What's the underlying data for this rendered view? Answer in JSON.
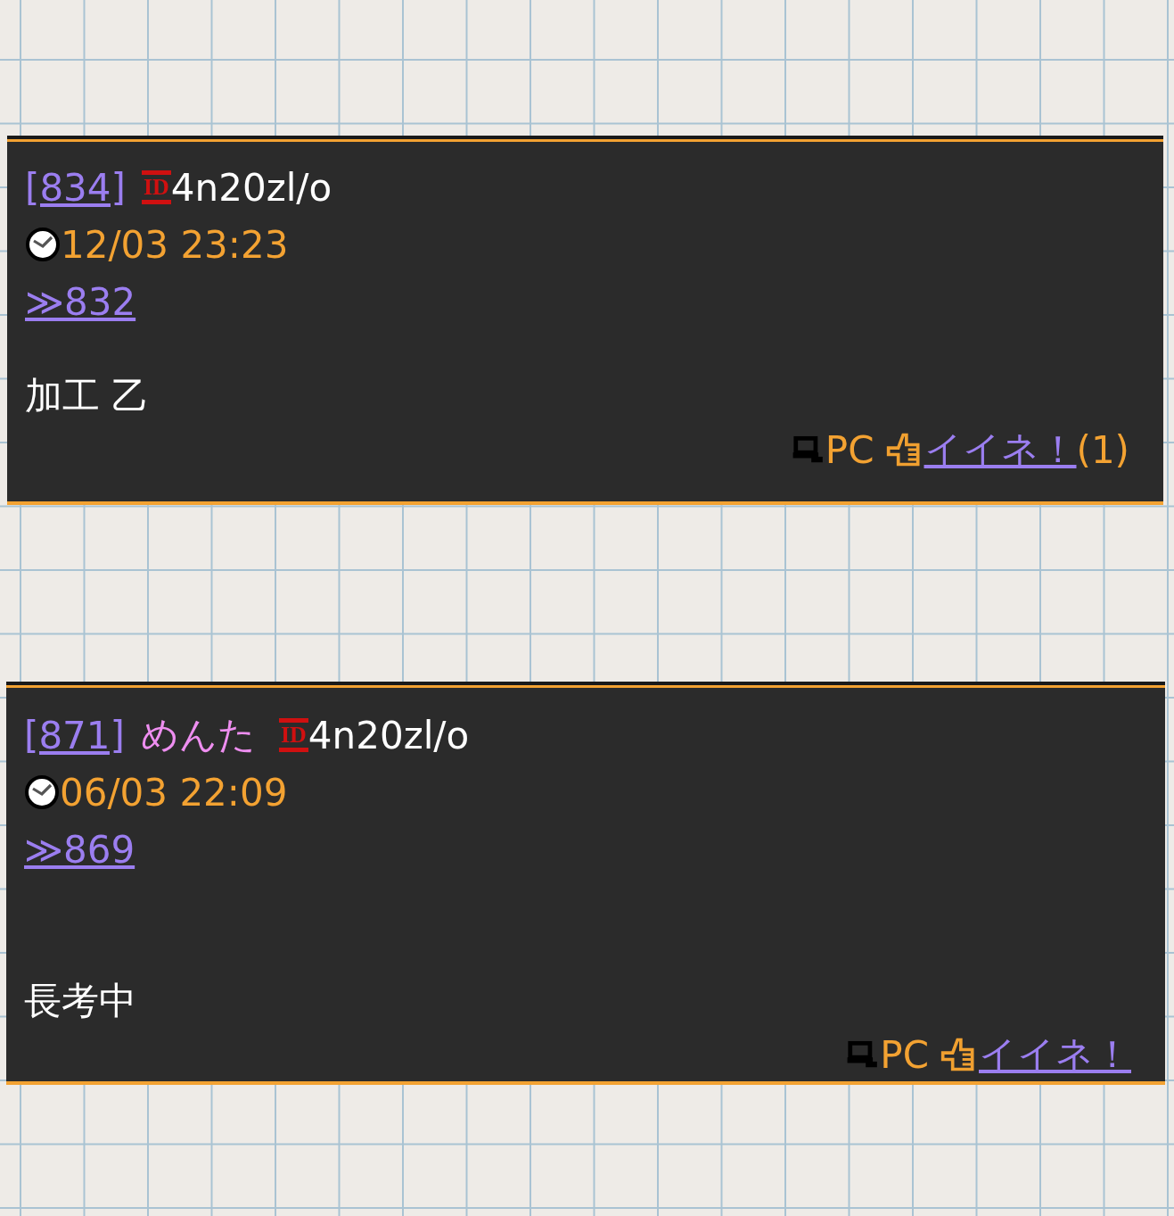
{
  "posts": [
    {
      "number": "[834]",
      "id_label": "ID",
      "id": "4n20zl/o",
      "date": "12/03 23:23",
      "reply": "≫832",
      "body": "加工 乙",
      "device": "PC",
      "like_label": "イイネ！",
      "like_count": "(1)"
    },
    {
      "number": "[871]",
      "name": "めんた",
      "id_label": "ID",
      "id": "4n20zl/o",
      "date": "06/03 22:09",
      "reply": "≫869",
      "body": "長考中",
      "device": "PC",
      "like_label": "イイネ！"
    }
  ]
}
